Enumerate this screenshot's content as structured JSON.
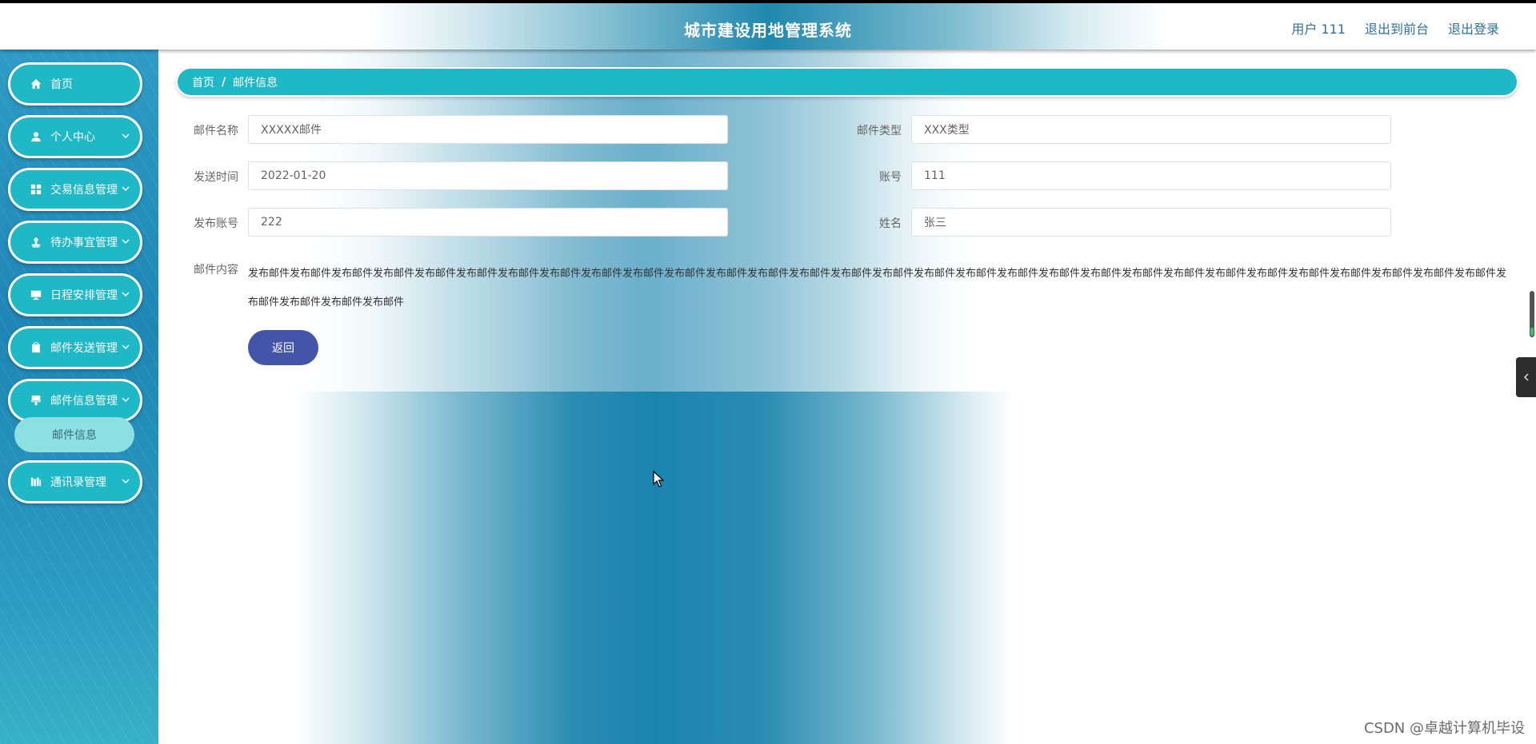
{
  "header": {
    "title": "城市建设用地管理系统",
    "user_label": "用户 111",
    "frontend_link": "退出到前台",
    "logout_link": "退出登录"
  },
  "sidebar": {
    "items": [
      {
        "label": "首页",
        "icon": "home-icon"
      },
      {
        "label": "个人中心",
        "icon": "user-icon"
      },
      {
        "label": "交易信息管理",
        "icon": "grid-icon"
      },
      {
        "label": "待办事宜管理",
        "icon": "stamp-icon"
      },
      {
        "label": "日程安排管理",
        "icon": "monitor-icon"
      },
      {
        "label": "邮件发送管理",
        "icon": "clipboard-icon"
      },
      {
        "label": "邮件信息管理",
        "icon": "brush-icon"
      },
      {
        "label": "通讯录管理",
        "icon": "book-icon"
      }
    ],
    "submenu_active": "邮件信息"
  },
  "breadcrumb": {
    "home": "首页",
    "separator": "/",
    "current": "邮件信息"
  },
  "form": {
    "mail_name": {
      "label": "邮件名称",
      "value": "XXXXX邮件"
    },
    "mail_type": {
      "label": "邮件类型",
      "value": "XXX类型"
    },
    "send_time": {
      "label": "发送时间",
      "value": "2022-01-20"
    },
    "account": {
      "label": "账号",
      "value": "111"
    },
    "publish_account": {
      "label": "发布账号",
      "value": "222"
    },
    "name": {
      "label": "姓名",
      "value": "张三"
    },
    "content": {
      "label": "邮件内容",
      "value": "发布邮件发布邮件发布邮件发布邮件发布邮件发布邮件发布邮件发布邮件发布邮件发布邮件发布邮件发布邮件发布邮件发布邮件发布邮件发布邮件发布邮件发布邮件发布邮件发布邮件发布邮件发布邮件发布邮件发布邮件发布邮件发布邮件发布邮件发布邮件发布邮件发布邮件发布邮件发布邮件发布邮件发布邮件"
    },
    "back_button": "返回"
  },
  "watermark": "CSDN @卓越计算机毕设",
  "colors": {
    "accent": "#1fb8c6",
    "button": "#4454a8",
    "submenu": "#8ce0e2"
  }
}
